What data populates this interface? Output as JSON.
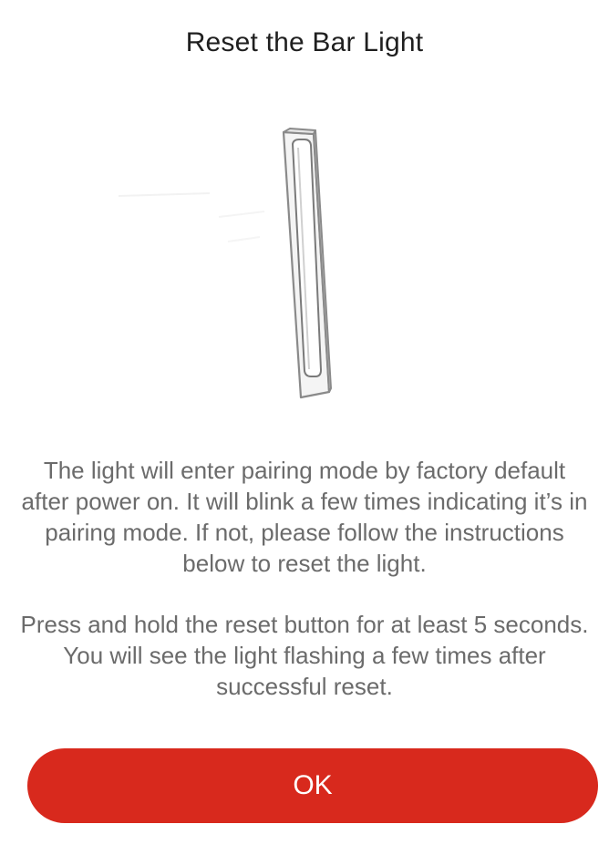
{
  "dialog": {
    "title": "Reset the Bar Light",
    "illustration_icon": "bar-light-icon",
    "paragraph_1": "The light will enter pairing mode by factory default after power on. It will blink a few times indicating it’s in pairing mode. If not, please follow the instructions below to reset the light.",
    "paragraph_2": "Press and hold the reset button for at least 5 seconds.  You will see the light flashing a few times after successful reset.",
    "ok_label": "OK"
  },
  "colors": {
    "accent": "#d8291d",
    "title_text": "#1f1f1f",
    "body_text": "#6b6b6b",
    "background": "#ffffff"
  }
}
